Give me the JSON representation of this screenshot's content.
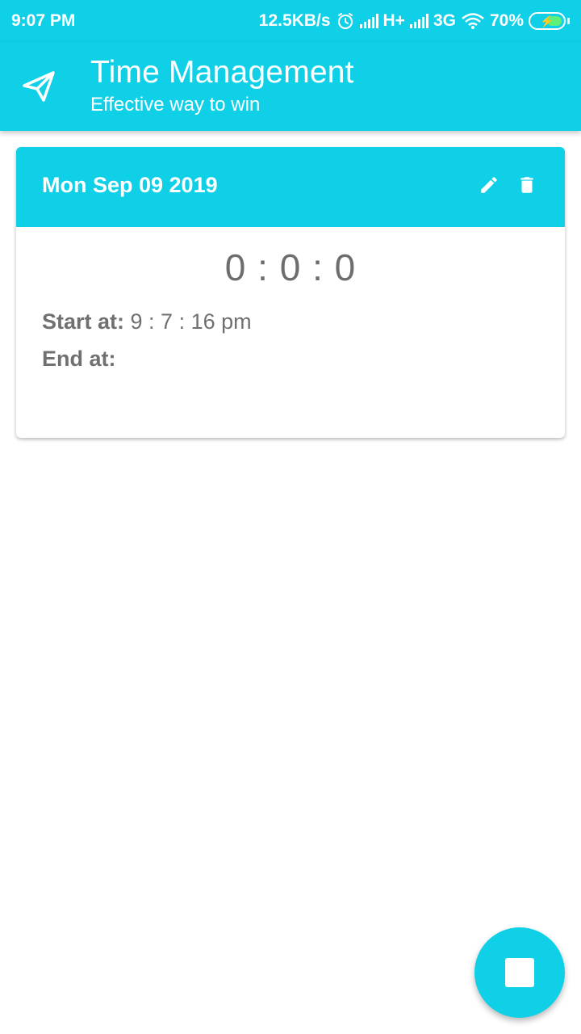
{
  "status_bar": {
    "time": "9:07 PM",
    "net_speed": "12.5KB/s",
    "network1": "H+",
    "network2": "3G",
    "battery": "70%"
  },
  "app_bar": {
    "title": "Time Management",
    "subtitle": "Effective way to win",
    "nav_icon": "send-icon"
  },
  "card": {
    "date": "Mon Sep 09 2019",
    "timer": "0 : 0 : 0",
    "start_label": "Start at:",
    "start_value": "9 : 7 : 16 pm",
    "end_label": "End at:",
    "end_value": "",
    "edit_icon": "pencil-icon",
    "delete_icon": "trash-icon"
  },
  "fab": {
    "icon": "stop-icon"
  },
  "colors": {
    "primary": "#10d0e8",
    "text_gray": "#707070",
    "white": "#ffffff"
  }
}
